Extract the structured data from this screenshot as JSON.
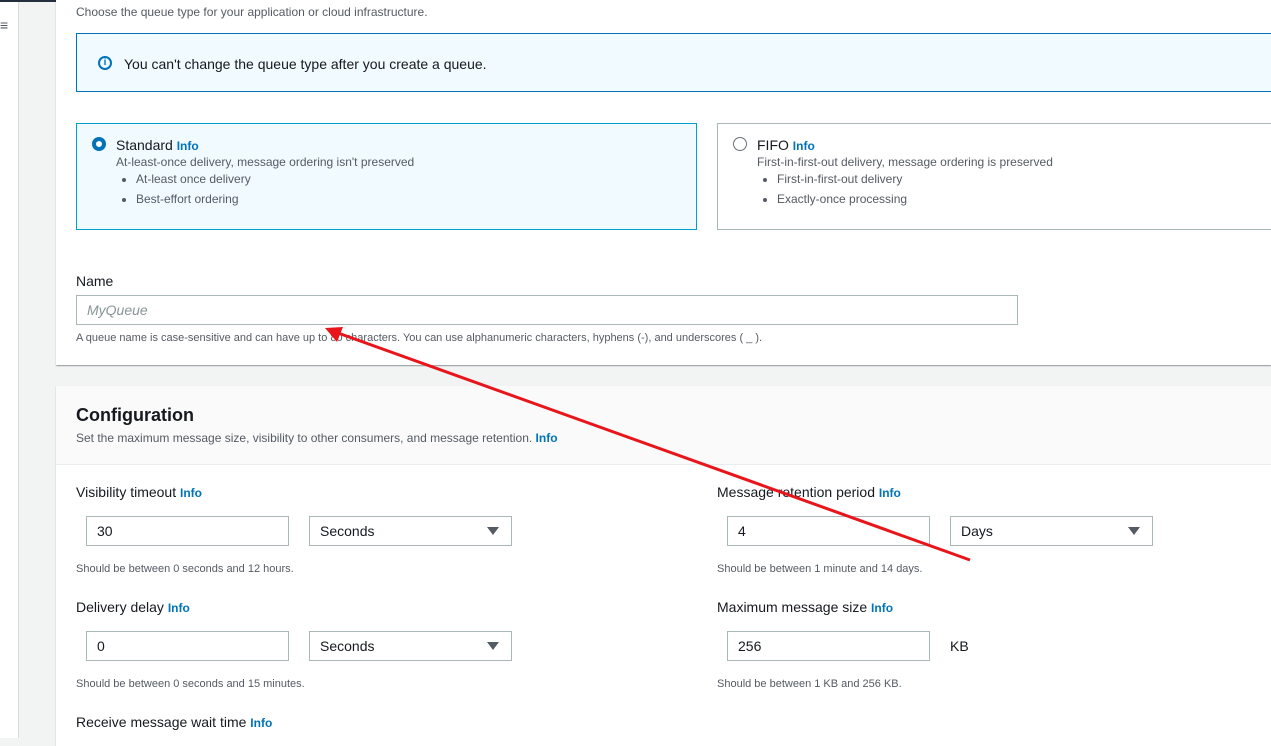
{
  "page": {
    "queue_type_help": "Choose the queue type for your application or cloud infrastructure.",
    "alert_text": "You can't change the queue type after you create a queue.",
    "info_label": "Info"
  },
  "queue_types": {
    "standard": {
      "title": "Standard",
      "description": "At-least-once delivery, message ordering isn't preserved",
      "bullets": [
        "At-least once delivery",
        "Best-effort ordering"
      ],
      "selected": true
    },
    "fifo": {
      "title": "FIFO",
      "description": "First-in-first-out delivery, message ordering is preserved",
      "bullets": [
        "First-in-first-out delivery",
        "Exactly-once processing"
      ],
      "selected": false
    }
  },
  "name_field": {
    "label": "Name",
    "placeholder": "MyQueue",
    "hint": "A queue name is case-sensitive and can have up to 80 characters. You can use alphanumeric characters, hyphens (-), and underscores ( _ )."
  },
  "configuration": {
    "title": "Configuration",
    "description": "Set the maximum message size, visibility to other consumers, and message retention.",
    "visibility_timeout": {
      "label": "Visibility timeout",
      "value": "30",
      "unit": "Seconds",
      "hint": "Should be between 0 seconds and 12 hours."
    },
    "message_retention": {
      "label": "Message retention period",
      "value": "4",
      "unit": "Days",
      "hint": "Should be between 1 minute and 14 days."
    },
    "delivery_delay": {
      "label": "Delivery delay",
      "value": "0",
      "unit": "Seconds",
      "hint": "Should be between 0 seconds and 15 minutes."
    },
    "max_message_size": {
      "label": "Maximum message size",
      "value": "256",
      "unit": "KB",
      "hint": "Should be between 1 KB and 256 KB."
    },
    "receive_wait_time": {
      "label": "Receive message wait time"
    }
  },
  "colors": {
    "accent": "#0073bb",
    "annotation_arrow": "#e8151b"
  },
  "icons": {
    "menu": "hamburger-icon",
    "alert": "info-circle-icon",
    "select": "caret-down-icon"
  }
}
